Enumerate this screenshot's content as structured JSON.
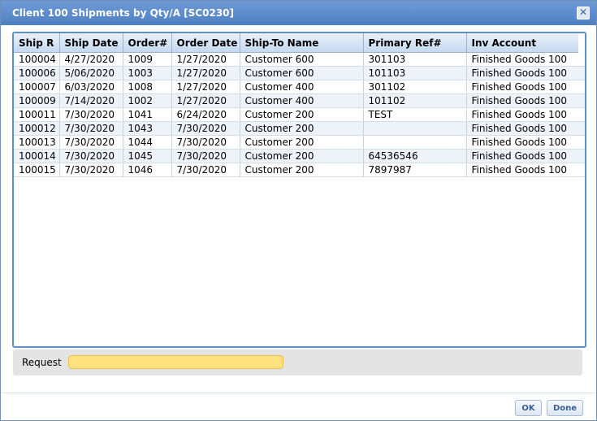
{
  "window": {
    "title": "Client 100 Shipments by Qty/A [SC0230]",
    "close_glyph": "✕"
  },
  "table": {
    "columns": [
      "Ship R",
      "Ship Date",
      "Order#",
      "Order Date",
      "Ship-To Name",
      "Primary Ref#",
      "Inv Account"
    ],
    "rows": [
      [
        "100004",
        "4/27/2020",
        "1009",
        "1/27/2020",
        "Customer 600",
        "301103",
        "Finished Goods 100"
      ],
      [
        "100006",
        "5/06/2020",
        "1003",
        "1/27/2020",
        "Customer 600",
        "101103",
        "Finished Goods 100"
      ],
      [
        "100007",
        "6/03/2020",
        "1008",
        "1/27/2020",
        "Customer 400",
        "301102",
        "Finished Goods 100"
      ],
      [
        "100009",
        "7/14/2020",
        "1002",
        "1/27/2020",
        "Customer 400",
        "101102",
        "Finished Goods 100"
      ],
      [
        "100011",
        "7/30/2020",
        "1041",
        "6/24/2020",
        "Customer 200",
        "TEST",
        "Finished Goods 100"
      ],
      [
        "100012",
        "7/30/2020",
        "1043",
        "7/30/2020",
        "Customer 200",
        "",
        "Finished Goods 100"
      ],
      [
        "100013",
        "7/30/2020",
        "1044",
        "7/30/2020",
        "Customer 200",
        "",
        "Finished Goods 100"
      ],
      [
        "100014",
        "7/30/2020",
        "1045",
        "7/30/2020",
        "Customer 200",
        "64536546",
        "Finished Goods 100"
      ],
      [
        "100015",
        "7/30/2020",
        "1046",
        "7/30/2020",
        "Customer 200",
        "7897987",
        "Finished Goods 100"
      ]
    ]
  },
  "request": {
    "label": "Request",
    "value": ""
  },
  "buttons": {
    "ok_label": "OK",
    "done_label": "Done"
  },
  "colors": {
    "titlebar": "#5a8acb",
    "grid_border": "#5b90c8",
    "request_input": "#ffe27d"
  }
}
